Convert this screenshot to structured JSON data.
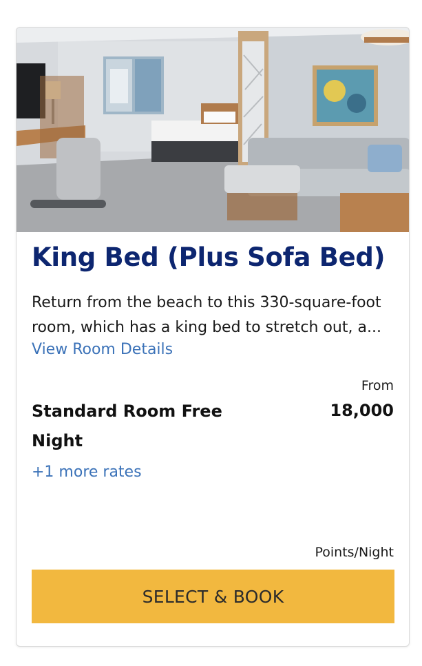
{
  "room": {
    "title": "King Bed (Plus Sofa Bed)",
    "description": "Return from the beach to this 330-square-foot room, which has a king bed to stretch out, a...",
    "details_link": "View Room Details"
  },
  "rate": {
    "from_label": "From",
    "name": "Standard Room Free Night",
    "points": "18,000",
    "more_rates": "+1 more rates",
    "unit": "Points/Night"
  },
  "cta": {
    "label": "SELECT & BOOK"
  },
  "colors": {
    "title": "#0d2670",
    "link": "#3b72b8",
    "button": "#f2b83f"
  }
}
